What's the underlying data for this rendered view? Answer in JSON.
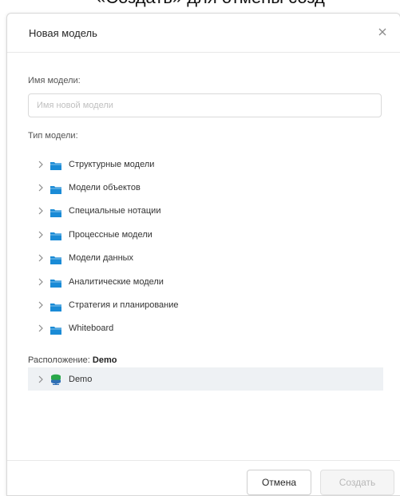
{
  "background_text": "«Создать» для отмены созд",
  "dialog": {
    "title": "Новая модель",
    "close_icon": "close-icon"
  },
  "name_field": {
    "label": "Имя модели:",
    "placeholder": "Имя новой модели",
    "value": ""
  },
  "model_type": {
    "label": "Тип модели:",
    "items": [
      {
        "label": "Структурные модели",
        "icon": "folder-icon"
      },
      {
        "label": "Модели объектов",
        "icon": "folder-icon"
      },
      {
        "label": "Специальные нотации",
        "icon": "folder-icon"
      },
      {
        "label": "Процессные модели",
        "icon": "folder-icon"
      },
      {
        "label": "Модели данных",
        "icon": "folder-icon"
      },
      {
        "label": "Аналитические модели",
        "icon": "folder-icon"
      },
      {
        "label": "Стратегия и планирование",
        "icon": "folder-icon"
      },
      {
        "label": "Whiteboard",
        "icon": "folder-icon"
      }
    ]
  },
  "location": {
    "label": "Расположение:",
    "value": "Demo",
    "tree_item": {
      "label": "Demo",
      "icon": "database-icon"
    }
  },
  "footer": {
    "cancel_label": "Отмена",
    "create_label": "Создать"
  },
  "colors": {
    "folder": "#1a8bd6",
    "db_top": "#2aa84a",
    "db_bottom": "#2f6fb5",
    "selected_row": "#eef1f4"
  }
}
